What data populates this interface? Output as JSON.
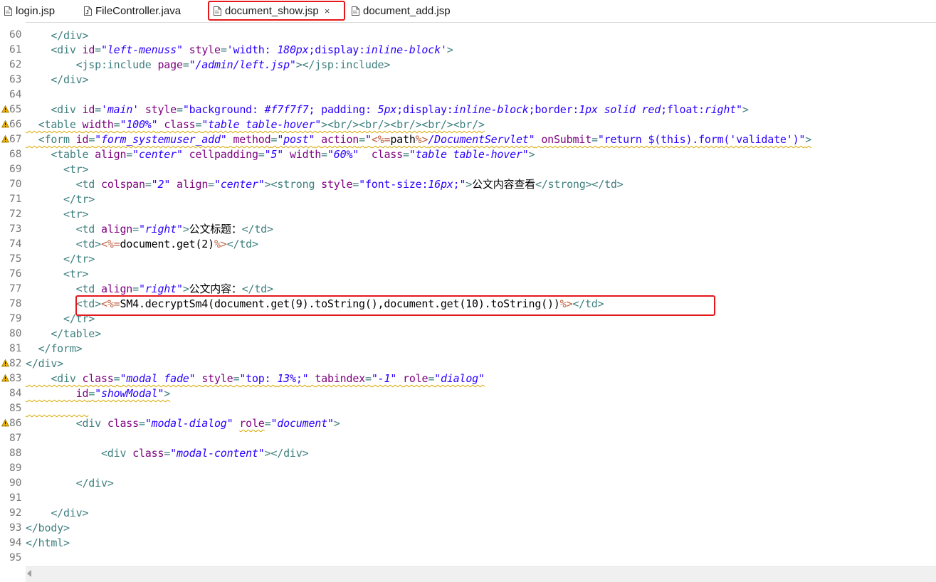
{
  "tabs": [
    {
      "label": "login.jsp",
      "icon": "jsp-file-icon"
    },
    {
      "label": "FileController.java",
      "icon": "java-file-icon"
    },
    {
      "label": "document_show.jsp",
      "icon": "jsp-file-icon",
      "active": true,
      "closable": true
    },
    {
      "label": "document_add.jsp",
      "icon": "jsp-file-icon"
    }
  ],
  "close_glyph": "×",
  "colors": {
    "highlight": "#e5171b",
    "tag": "#3f7f7f",
    "attribute": "#7f007f",
    "string": "#2a00ff",
    "jsp_delimiter": "#bf5f3f",
    "line_number": "#787878",
    "warning": "#e8b100"
  },
  "editor": {
    "partial_top_line": "    </div>",
    "lines": [
      {
        "n": "60",
        "segs": []
      },
      {
        "n": "61",
        "segs": [
          [
            "t",
            "    <div "
          ],
          [
            "a",
            "id"
          ],
          [
            "t",
            "="
          ],
          [
            "v",
            "\"left-menuss\""
          ],
          [
            "t",
            " "
          ],
          [
            "a",
            "style"
          ],
          [
            "t",
            "="
          ],
          [
            "s",
            "'width: "
          ],
          [
            "v",
            "180px"
          ],
          [
            "s",
            ";display:"
          ],
          [
            "v",
            "inline-block"
          ],
          [
            "s",
            "'"
          ],
          [
            "t",
            ">"
          ]
        ]
      },
      {
        "n": "62",
        "segs": [
          [
            "t",
            "        <jsp:include "
          ],
          [
            "a",
            "page"
          ],
          [
            "t",
            "="
          ],
          [
            "v",
            "\"/admin/left.jsp\""
          ],
          [
            "t",
            "></jsp:include>"
          ]
        ]
      },
      {
        "n": "63",
        "segs": [
          [
            "t",
            "    </div>"
          ]
        ]
      },
      {
        "n": "64",
        "segs": []
      },
      {
        "n": "65",
        "warn": true,
        "segs": [
          [
            "t",
            "    <div "
          ],
          [
            "a",
            "id"
          ],
          [
            "t",
            "="
          ],
          [
            "v",
            "'main'"
          ],
          [
            "t",
            " "
          ],
          [
            "a",
            "style"
          ],
          [
            "t",
            "="
          ],
          [
            "s",
            "\"background: "
          ],
          [
            "v",
            "#f7f7f7"
          ],
          [
            "s",
            "; padding: "
          ],
          [
            "v",
            "5px"
          ],
          [
            "s",
            ";display:"
          ],
          [
            "v",
            "inline-block"
          ],
          [
            "s",
            ";border:"
          ],
          [
            "v",
            "1px solid red"
          ],
          [
            "s",
            ";float:"
          ],
          [
            "v",
            "right"
          ],
          [
            "s",
            "\""
          ],
          [
            "t",
            ">"
          ]
        ]
      },
      {
        "n": "66",
        "warn": true,
        "wavy": true,
        "segs": [
          [
            "t",
            "  <table "
          ],
          [
            "a",
            "width"
          ],
          [
            "t",
            "="
          ],
          [
            "v",
            "\"100%\""
          ],
          [
            "t",
            " "
          ],
          [
            "a",
            "class"
          ],
          [
            "t",
            "="
          ],
          [
            "v",
            "\"table table-hover\""
          ],
          [
            "t",
            "><br/><br/><br/><br/><br/>"
          ]
        ]
      },
      {
        "n": "67",
        "warn": true,
        "wavy": true,
        "segs": [
          [
            "t",
            "  <form "
          ],
          [
            "a",
            "id"
          ],
          [
            "t",
            "="
          ],
          [
            "v",
            "\"form_systemuser_add\""
          ],
          [
            "t",
            " "
          ],
          [
            "a",
            "method"
          ],
          [
            "t",
            "="
          ],
          [
            "v",
            "\"post\""
          ],
          [
            "t",
            " "
          ],
          [
            "a",
            "action"
          ],
          [
            "t",
            "="
          ],
          [
            "s",
            "\""
          ],
          [
            "j",
            "<%="
          ],
          [
            "k",
            "path"
          ],
          [
            "j",
            "%>"
          ],
          [
            "v",
            "/DocumentServlet\""
          ],
          [
            "t",
            " "
          ],
          [
            "a",
            "onSubmit"
          ],
          [
            "t",
            "="
          ],
          [
            "s",
            "\"return $(this).form('validate')\""
          ],
          [
            "t",
            ">"
          ]
        ]
      },
      {
        "n": "68",
        "segs": [
          [
            "t",
            "    <table "
          ],
          [
            "a",
            "align"
          ],
          [
            "t",
            "="
          ],
          [
            "v",
            "\"center\""
          ],
          [
            "t",
            " "
          ],
          [
            "a",
            "cellpadding"
          ],
          [
            "t",
            "="
          ],
          [
            "v",
            "\"5\""
          ],
          [
            "t",
            " "
          ],
          [
            "a",
            "width"
          ],
          [
            "t",
            "="
          ],
          [
            "v",
            "\"60%\""
          ],
          [
            "t",
            "  "
          ],
          [
            "a",
            "class"
          ],
          [
            "t",
            "="
          ],
          [
            "v",
            "\"table table-hover\""
          ],
          [
            "t",
            ">"
          ]
        ]
      },
      {
        "n": "69",
        "segs": [
          [
            "t",
            "      <tr>"
          ]
        ]
      },
      {
        "n": "70",
        "segs": [
          [
            "t",
            "        <td "
          ],
          [
            "a",
            "colspan"
          ],
          [
            "t",
            "="
          ],
          [
            "v",
            "\"2\""
          ],
          [
            "t",
            " "
          ],
          [
            "a",
            "align"
          ],
          [
            "t",
            "="
          ],
          [
            "v",
            "\"center\""
          ],
          [
            "t",
            "><strong "
          ],
          [
            "a",
            "style"
          ],
          [
            "t",
            "="
          ],
          [
            "s",
            "\"font-size:"
          ],
          [
            "v",
            "16px"
          ],
          [
            "s",
            ";\""
          ],
          [
            "t",
            ">"
          ],
          [
            "k",
            "公文内容查看"
          ],
          [
            "t",
            "</strong></td>"
          ]
        ]
      },
      {
        "n": "71",
        "segs": [
          [
            "t",
            "      </tr>"
          ]
        ]
      },
      {
        "n": "72",
        "segs": [
          [
            "t",
            "      <tr>"
          ]
        ]
      },
      {
        "n": "73",
        "segs": [
          [
            "t",
            "        <td "
          ],
          [
            "a",
            "align"
          ],
          [
            "t",
            "="
          ],
          [
            "v",
            "\"right\""
          ],
          [
            "t",
            ">"
          ],
          [
            "k",
            "公文标题："
          ],
          [
            "t",
            "</td>"
          ]
        ]
      },
      {
        "n": "74",
        "segs": [
          [
            "t",
            "        <td>"
          ],
          [
            "j",
            "<%="
          ],
          [
            "k",
            "document.get(2)"
          ],
          [
            "j",
            "%>"
          ],
          [
            "t",
            "</td>"
          ]
        ]
      },
      {
        "n": "75",
        "segs": [
          [
            "t",
            "      </tr>"
          ]
        ]
      },
      {
        "n": "76",
        "segs": [
          [
            "t",
            "      <tr>"
          ]
        ]
      },
      {
        "n": "77",
        "segs": [
          [
            "t",
            "        <td "
          ],
          [
            "a",
            "align"
          ],
          [
            "t",
            "="
          ],
          [
            "v",
            "\"right\""
          ],
          [
            "t",
            ">"
          ],
          [
            "k",
            "公文内容："
          ],
          [
            "t",
            "</td>"
          ]
        ]
      },
      {
        "n": "78",
        "segs": [
          [
            "t",
            "        <td>"
          ],
          [
            "j",
            "<%="
          ],
          [
            "k",
            "SM4.decryptSm4(document.get(9).toString(),document.get(10).toString())"
          ],
          [
            "j",
            "%>"
          ],
          [
            "t",
            "</td>"
          ]
        ]
      },
      {
        "n": "79",
        "segs": [
          [
            "t",
            "      </tr>"
          ]
        ]
      },
      {
        "n": "80",
        "segs": [
          [
            "t",
            "    </table>"
          ]
        ]
      },
      {
        "n": "81",
        "segs": [
          [
            "t",
            "  </form>"
          ]
        ]
      },
      {
        "n": "82",
        "warn": true,
        "segs": [
          [
            "t",
            "</div>"
          ]
        ]
      },
      {
        "n": "83",
        "warn": true,
        "wavy": true,
        "segs": [
          [
            "t",
            "    <div "
          ],
          [
            "a",
            "class"
          ],
          [
            "t",
            "="
          ],
          [
            "v",
            "\"modal fade\""
          ],
          [
            "t",
            " "
          ],
          [
            "a",
            "style"
          ],
          [
            "t",
            "="
          ],
          [
            "s",
            "\"top: "
          ],
          [
            "v",
            "13%"
          ],
          [
            "s",
            ";\""
          ],
          [
            "t",
            " "
          ],
          [
            "a",
            "tabindex"
          ],
          [
            "t",
            "="
          ],
          [
            "v",
            "\"-1\""
          ],
          [
            "t",
            " "
          ],
          [
            "a",
            "role"
          ],
          [
            "t",
            "="
          ],
          [
            "v",
            "\"dialog\""
          ]
        ]
      },
      {
        "n": "84",
        "wavy": true,
        "segs": [
          [
            "t",
            "        "
          ],
          [
            "a",
            "id"
          ],
          [
            "t",
            "="
          ],
          [
            "v",
            "\"showModal\""
          ],
          [
            "t",
            ">"
          ]
        ]
      },
      {
        "n": "85",
        "wavy": true,
        "segs": [
          [
            "t",
            "          "
          ]
        ]
      },
      {
        "n": "86",
        "warn": true,
        "segs": [
          [
            "t",
            "        <div "
          ],
          [
            "a",
            "class"
          ],
          [
            "t",
            "="
          ],
          [
            "v",
            "\"modal-dialog\""
          ],
          [
            "t",
            " "
          ],
          [
            "aw",
            "role"
          ],
          [
            "t",
            "="
          ],
          [
            "v",
            "\"document\""
          ],
          [
            "t",
            ">"
          ]
        ]
      },
      {
        "n": "87",
        "segs": []
      },
      {
        "n": "88",
        "segs": [
          [
            "t",
            "            <div "
          ],
          [
            "a",
            "class"
          ],
          [
            "t",
            "="
          ],
          [
            "v",
            "\"modal-content\""
          ],
          [
            "t",
            "></div>"
          ]
        ]
      },
      {
        "n": "89",
        "segs": []
      },
      {
        "n": "90",
        "segs": [
          [
            "t",
            "        </div>"
          ]
        ]
      },
      {
        "n": "91",
        "segs": []
      },
      {
        "n": "92",
        "segs": [
          [
            "t",
            "    </div>"
          ]
        ]
      },
      {
        "n": "93",
        "segs": [
          [
            "t",
            "</body>"
          ]
        ]
      },
      {
        "n": "94",
        "segs": [
          [
            "t",
            "</html>"
          ]
        ]
      },
      {
        "n": "95",
        "segs": []
      }
    ]
  }
}
